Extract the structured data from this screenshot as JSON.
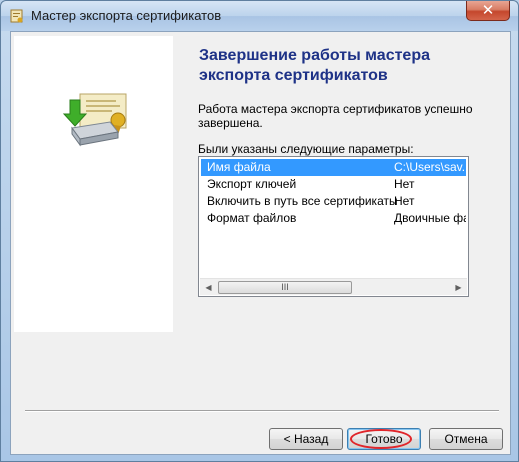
{
  "window": {
    "title": "Мастер экспорта сертификатов",
    "close_glyph": "✕"
  },
  "wizard": {
    "heading": "Завершение работы мастера экспорта сертификатов",
    "success_text": "Работа мастера экспорта сертификатов успешно завершена.",
    "params_label": "Были указаны следующие параметры:",
    "parameters": [
      {
        "name": "Имя файла",
        "value": "C:\\Users\\sav.D"
      },
      {
        "name": "Экспорт ключей",
        "value": "Нет"
      },
      {
        "name": "Включить в путь все сертификаты",
        "value": "Нет"
      },
      {
        "name": "Формат файлов",
        "value": "Двоичные фай"
      }
    ],
    "selected_row": 0
  },
  "scrollbar": {
    "left_arrow": "◀",
    "right_arrow": "▶",
    "thumb_grip": "III"
  },
  "buttons": {
    "back": "< Назад",
    "finish": "Готово",
    "cancel": "Отмена"
  },
  "icons": {
    "title": "certificate-wizard-icon",
    "art": "certificate-export-icon"
  },
  "colors": {
    "heading": "#1e3287",
    "selection": "#3399ff",
    "annotation": "#e0262b"
  }
}
